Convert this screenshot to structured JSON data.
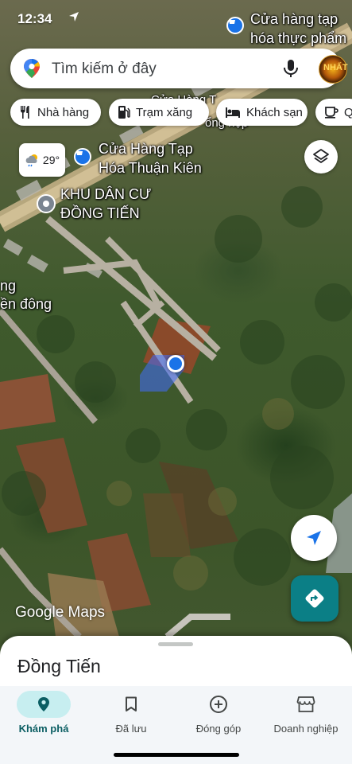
{
  "status_bar": {
    "time": "12:34"
  },
  "search": {
    "placeholder": "Tìm kiếm ở đây",
    "avatar_text": "NHẤT"
  },
  "chips": [
    {
      "label": "Nhà hàng",
      "icon": "fork-knife-icon"
    },
    {
      "label": "Trạm xăng",
      "icon": "gas-pump-icon"
    },
    {
      "label": "Khách sạn",
      "icon": "bed-icon"
    },
    {
      "label": "Q",
      "icon": "coffee-cup-icon"
    }
  ],
  "weather": {
    "temperature": "29°",
    "icon": "partly-cloudy-rain-icon"
  },
  "map_labels": {
    "store_top": [
      "Cửa hàng tạp",
      "hóa thực phẩm"
    ],
    "store_mid": "Cửa Hàng T",
    "store_mid_2": "ổng họp",
    "store_thuan_kien": [
      "Cửa Hàng Tạp",
      "Hóa Thuận Kiên"
    ],
    "residential": [
      "KHU DÂN CƯ",
      "ĐỒNG TIẾN"
    ],
    "left_edge": [
      "ng",
      "ền đông"
    ],
    "brand": "Google Maps"
  },
  "sheet": {
    "title": "Đồng Tiến"
  },
  "bottom_nav": [
    {
      "label": "Khám phá",
      "icon": "explore-pin-icon",
      "active": true
    },
    {
      "label": "Đã lưu",
      "icon": "bookmark-icon",
      "active": false
    },
    {
      "label": "Đóng góp",
      "icon": "add-circle-icon",
      "active": false
    },
    {
      "label": "Doanh nghiệp",
      "icon": "storefront-icon",
      "active": false
    }
  ],
  "colors": {
    "accent_blue": "#1a73e8",
    "directions_teal": "#0b7f86",
    "nav_active_bg": "#c7eef0"
  }
}
